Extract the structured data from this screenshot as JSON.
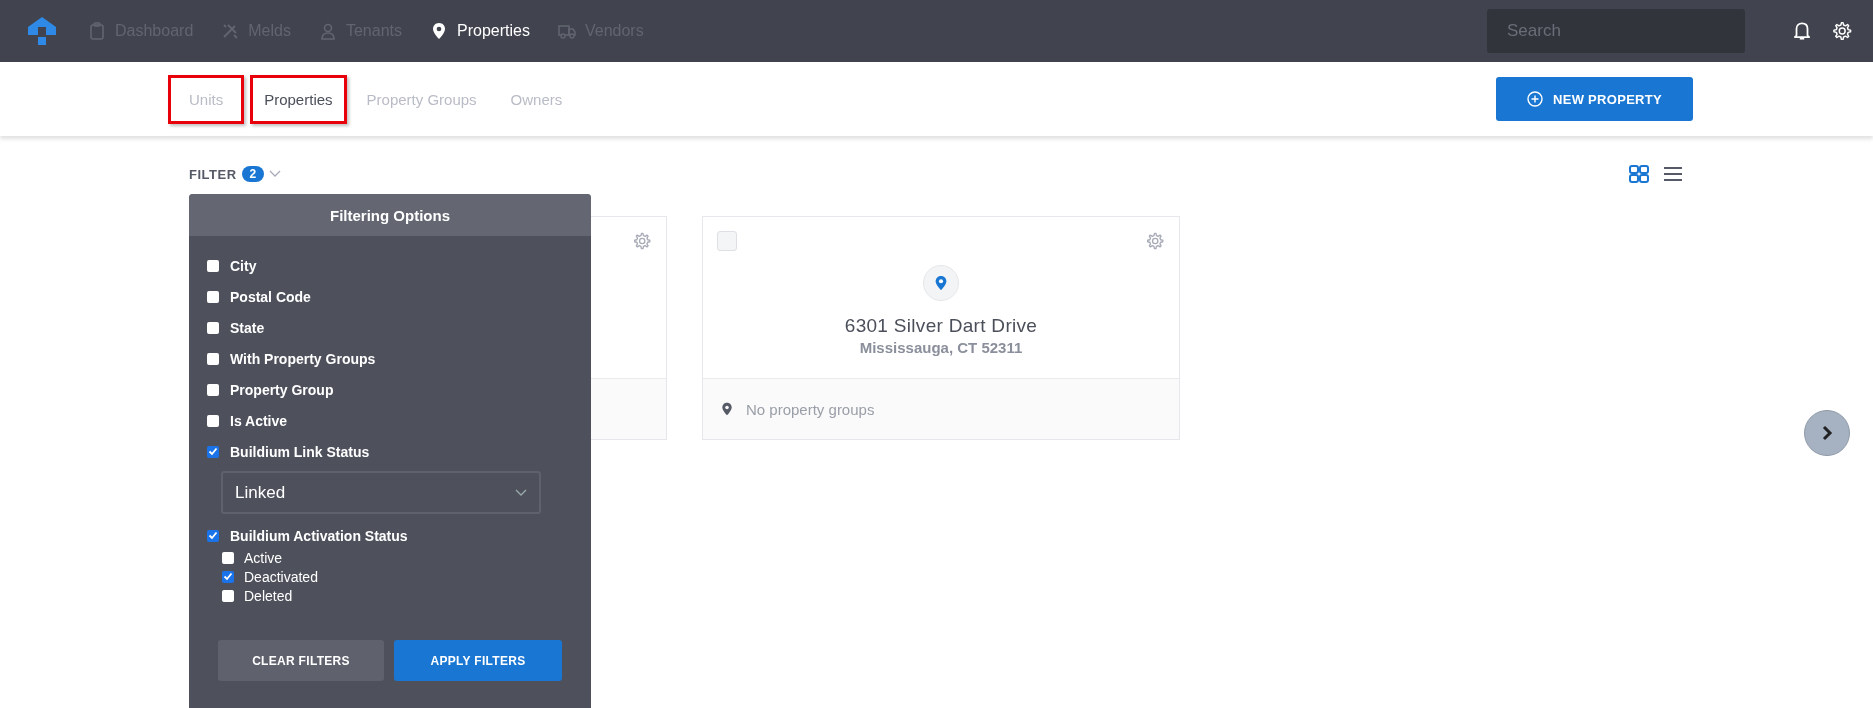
{
  "nav": {
    "items": [
      {
        "label": "Dashboard",
        "selected": false
      },
      {
        "label": "Melds",
        "selected": false
      },
      {
        "label": "Tenants",
        "selected": false
      },
      {
        "label": "Properties",
        "selected": true
      },
      {
        "label": "Vendors",
        "selected": false
      }
    ]
  },
  "search": {
    "placeholder": "Search"
  },
  "subtabs": [
    {
      "label": "Units",
      "selected": false,
      "highlighted": true
    },
    {
      "label": "Properties",
      "selected": true,
      "highlighted": true
    },
    {
      "label": "Property Groups",
      "selected": false,
      "highlighted": false
    },
    {
      "label": "Owners",
      "selected": false,
      "highlighted": false
    }
  ],
  "new_button": {
    "label": "NEW PROPERTY"
  },
  "filter": {
    "label": "FILTER",
    "count": "2"
  },
  "view_modes": [
    {
      "kind": "grid",
      "selected": true
    },
    {
      "kind": "list",
      "selected": false
    }
  ],
  "cards": [
    {
      "kind": "covered"
    },
    {
      "kind": "full",
      "checked": false,
      "title": "6301 Silver Dart Drive",
      "subtitle": "Mississauga, CT 52311",
      "groups": "No property groups"
    }
  ],
  "filter_panel": {
    "title": "Filtering Options",
    "options": [
      {
        "label": "City",
        "checked": false
      },
      {
        "label": "Postal Code",
        "checked": false
      },
      {
        "label": "State",
        "checked": false
      },
      {
        "label": "With Property Groups",
        "checked": false
      },
      {
        "label": "Property Group",
        "checked": false
      },
      {
        "label": "Is Active",
        "checked": false
      },
      {
        "label": "Buildium Link Status",
        "checked": true,
        "select": {
          "value": "Linked"
        }
      },
      {
        "label": "Buildium Activation Status",
        "checked": true,
        "choices": [
          {
            "label": "Active",
            "checked": false
          },
          {
            "label": "Deactivated",
            "checked": true
          },
          {
            "label": "Deleted",
            "checked": false
          }
        ]
      }
    ],
    "buttons": [
      {
        "label": "CLEAR FILTERS",
        "kind": "secondary"
      },
      {
        "label": "APPLY FILTERS",
        "kind": "primary"
      }
    ]
  }
}
